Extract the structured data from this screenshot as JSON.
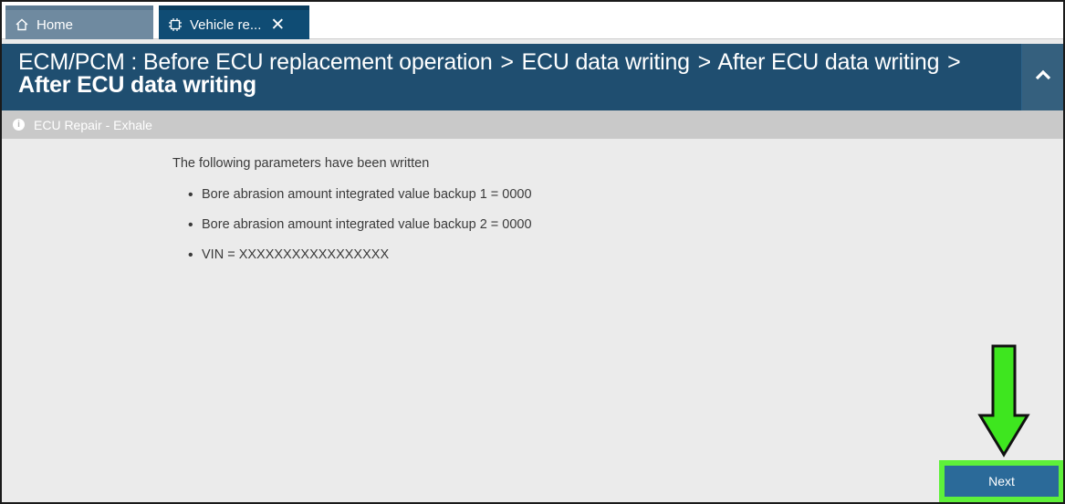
{
  "tabs": {
    "home": {
      "label": "Home",
      "icon": "home-icon"
    },
    "vehicle": {
      "label": "Vehicle re...",
      "icon": "chip-icon",
      "close": "✕"
    }
  },
  "header": {
    "segment_1": "ECM/PCM",
    "colon": " : ",
    "segment_2": "Before ECU replacement operation",
    "segment_3": "ECU data writing",
    "segment_4": "After ECU data writing",
    "segment_current": "After ECU data writing",
    "separator": ">",
    "collapse_icon": "chevron-up-icon"
  },
  "infobar": {
    "icon": "info-icon",
    "icon_glyph": "i",
    "text": "ECU Repair - Exhale"
  },
  "content": {
    "message": "The following parameters have been written",
    "parameters": [
      "Bore abrasion amount integrated value backup 1 = 0000",
      "Bore abrasion amount integrated value backup 2 = 0000",
      "VIN = XXXXXXXXXXXXXXXXX"
    ],
    "bullet": "•"
  },
  "footer": {
    "next_label": "Next",
    "highlight_color": "#5ef03a",
    "arrow_color": "#3ee61f"
  },
  "colors": {
    "header_bg": "#1f4e70",
    "active_tab": "#0f4c74",
    "inactive_tab": "#6f8aa0",
    "button_bg": "#2b6a99"
  }
}
